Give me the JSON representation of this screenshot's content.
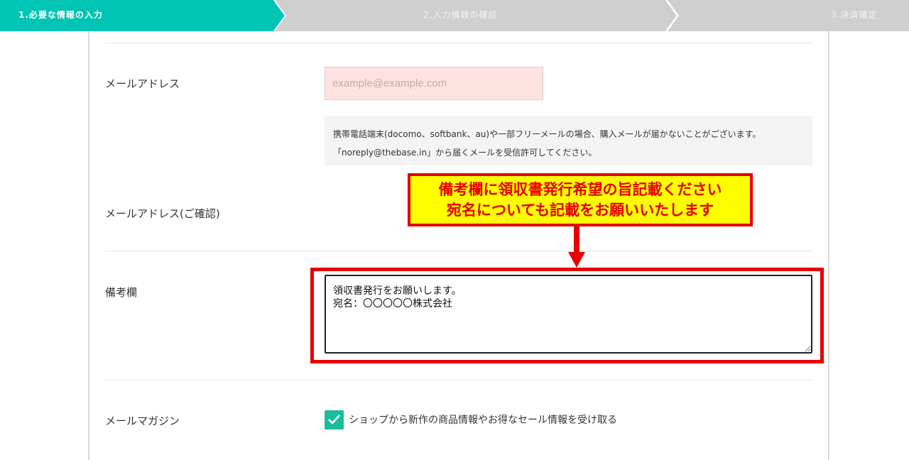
{
  "steps": [
    {
      "label": "1.必要な情報の入力",
      "active": true
    },
    {
      "label": "2.入力情報の確認",
      "active": false
    },
    {
      "label": "3.決済確定",
      "active": false
    }
  ],
  "colors": {
    "accent": "#00c4b4",
    "inactive_step": "#cfcfcf",
    "alert": "#e60000",
    "callout_bg": "#ffff00",
    "input_error_bg": "#ffe3e3"
  },
  "email": {
    "label": "メールアドレス",
    "placeholder": "example@example.com",
    "value": "",
    "notice_line1": "携帯電話端末(docomo、softbank、au)や一部フリーメールの場合、購入メールが届かないことがございます。",
    "notice_line2": "「noreply@thebase.in」から届くメールを受信許可してください。"
  },
  "email_confirm": {
    "label": "メールアドレス(ご確認)"
  },
  "callout": {
    "line1": "備考欄に領収書発行希望の旨記載ください",
    "line2": "宛名についても記載をお願いいたします"
  },
  "memo": {
    "label": "備考欄",
    "value": "領収書発行をお願いします。\n宛名：〇〇〇〇〇株式会社"
  },
  "newsletter": {
    "label": "メールマガジン",
    "checked": true,
    "option_label": "ショップから新作の商品情報やお得なセール情報を受け取る"
  }
}
